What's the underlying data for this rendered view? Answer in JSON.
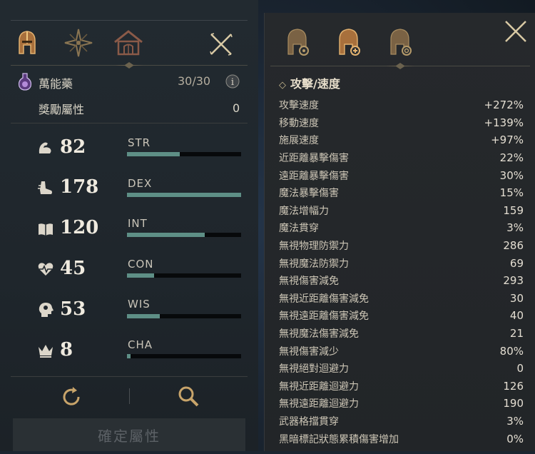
{
  "left_panel": {
    "potion": {
      "name": "萬能藥",
      "count": "30/30"
    },
    "bonus": {
      "label": "獎勵屬性",
      "value": "0"
    },
    "stats": [
      {
        "icon": "arm-icon",
        "value": "82",
        "name": "STR",
        "fill": 0.46
      },
      {
        "icon": "boot-icon",
        "value": "178",
        "name": "DEX",
        "fill": 1.0
      },
      {
        "icon": "book-icon",
        "value": "120",
        "name": "INT",
        "fill": 0.68
      },
      {
        "icon": "heart-pulse-icon",
        "value": "45",
        "name": "CON",
        "fill": 0.24
      },
      {
        "icon": "head-icon",
        "value": "53",
        "name": "WIS",
        "fill": 0.29
      },
      {
        "icon": "crown-icon",
        "value": "8",
        "name": "CHA",
        "fill": 0.03
      }
    ],
    "confirm_label": "確定屬性"
  },
  "right_panel": {
    "section_title": "攻擊/速度",
    "attributes": [
      {
        "label": "攻擊速度",
        "value": "+272%"
      },
      {
        "label": "移動速度",
        "value": "+139%"
      },
      {
        "label": "施展速度",
        "value": "+97%"
      },
      {
        "label": "近距離暴擊傷害",
        "value": "22%"
      },
      {
        "label": "遠距離暴擊傷害",
        "value": "30%"
      },
      {
        "label": "魔法暴擊傷害",
        "value": "15%"
      },
      {
        "label": "魔法增幅力",
        "value": "159"
      },
      {
        "label": "魔法貫穿",
        "value": "3%"
      },
      {
        "label": "無視物理防禦力",
        "value": "286"
      },
      {
        "label": "無視魔法防禦力",
        "value": "69"
      },
      {
        "label": "無視傷害減免",
        "value": "293"
      },
      {
        "label": "無視近距離傷害減免",
        "value": "30"
      },
      {
        "label": "無視遠距離傷害減免",
        "value": "40"
      },
      {
        "label": "無視魔法傷害減免",
        "value": "21"
      },
      {
        "label": "無視傷害減少",
        "value": "80%"
      },
      {
        "label": "無視絕對迴避力",
        "value": "0"
      },
      {
        "label": "無視近距離迴避力",
        "value": "126"
      },
      {
        "label": "無視遠距離迴避力",
        "value": "190"
      },
      {
        "label": "武器格擋貫穿",
        "value": "3%"
      },
      {
        "label": "黑暗標記狀態累積傷害增加",
        "value": "0%"
      }
    ]
  },
  "colors": {
    "accent": "#c8a46a",
    "bar_fill": "#5e8f86",
    "bar_bg": "#07090b"
  }
}
